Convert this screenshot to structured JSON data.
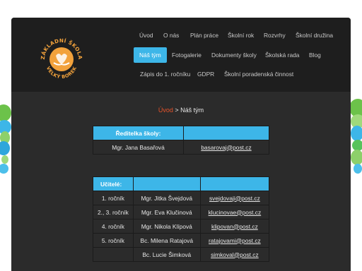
{
  "logo": {
    "arc_top": "ZÁKLADNÍ ŠKOLA",
    "arc_bottom": "VELKÝ BOREK",
    "color": "#f2a23c"
  },
  "nav": {
    "row1": [
      "Úvod",
      "O nás",
      "Plán práce",
      "Školní rok",
      "Rozvrhy",
      "Školní družina"
    ],
    "row2": [
      "Náš tým",
      "Fotogalerie",
      "Dokumenty školy",
      "Školská rada",
      "Blog"
    ],
    "row3": [
      "Zápis do 1. ročníku",
      "GDPR",
      "Školní poradenská činnost"
    ],
    "active_color": "#3db6e8"
  },
  "breadcrumb": {
    "home": "Úvod",
    "separator": ">",
    "current": "Náš tým"
  },
  "director_table": {
    "header": "Ředitelka školy:",
    "name": "Mgr. Jana Basařová",
    "email": "basarovaj@post.cz"
  },
  "teachers_table": {
    "header": "Učitelé:",
    "rows": [
      {
        "grade": "1. ročník",
        "name": "Mgr. Jitka Švejdová",
        "email": "svejdovaji@post.cz"
      },
      {
        "grade": "2., 3. ročník",
        "name": "Mgr. Eva Klučinová",
        "email": "klucinovae@post.cz"
      },
      {
        "grade": "4. ročník",
        "name": "Mgr. Nikola Klípová",
        "email": "klipovan@post.cz"
      },
      {
        "grade": "5. ročník",
        "name": "Bc. Milena Ratajová",
        "email": "ratajovami@post.cz"
      },
      {
        "grade": "",
        "name": "Bc. Lucie Šimková",
        "email": "simkoval@post.cz"
      }
    ]
  },
  "colors": {
    "accent": "#3db6e8",
    "link": "#e8532b",
    "header_bg": "#1e1e1e",
    "content_bg": "#2b2b2b"
  }
}
